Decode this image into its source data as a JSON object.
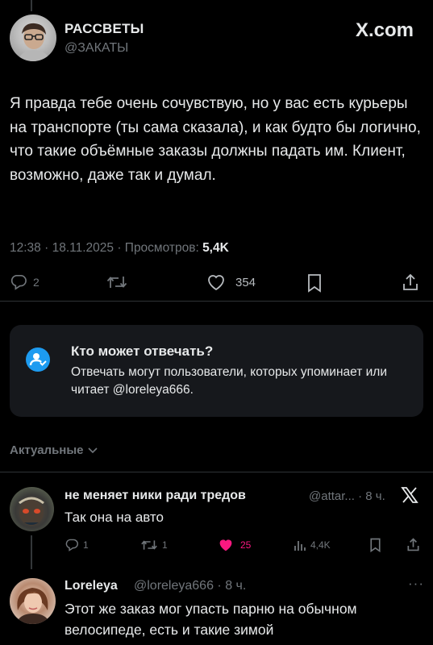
{
  "post": {
    "display_name": "РАССВЕТЫ",
    "handle": "@ЗАКАТЫ",
    "brand": "X.com",
    "text": "Я правда тебе очень сочувствую, но у вас есть курьеры на транспорте (ты сама сказала), и как будто бы логично, что такие объёмные заказы должны падать им. Клиент, возможно, даже так и думал.",
    "time": "12:38",
    "date": "18.11.2025",
    "views_label": "Просмотров:",
    "views_count": "5,4K",
    "replies": "2",
    "likes": "354"
  },
  "reply_restriction": {
    "title": "Кто может отвечать?",
    "body": "Отвечать могут пользователи, которых упоминает или читает @loreleya666."
  },
  "sort": {
    "label": "Актуальные"
  },
  "replies": [
    {
      "display_name": "не меняет ники ради тредов",
      "handle_time": "@attar... · 8 ч.",
      "text": "Так она на авто",
      "replies": "1",
      "retweets": "1",
      "likes": "25",
      "views": "4,4K"
    },
    {
      "display_name": "Loreleya",
      "handle_time": "@loreleya666 · 8 ч.",
      "text": "Этот же заказ мог упасть парню на обычном велосипеде, есть и такие зимой"
    }
  ],
  "colors": {
    "accent": "#1d9bf0",
    "like": "#f91880",
    "muted": "#71767b",
    "background": "#000000"
  }
}
